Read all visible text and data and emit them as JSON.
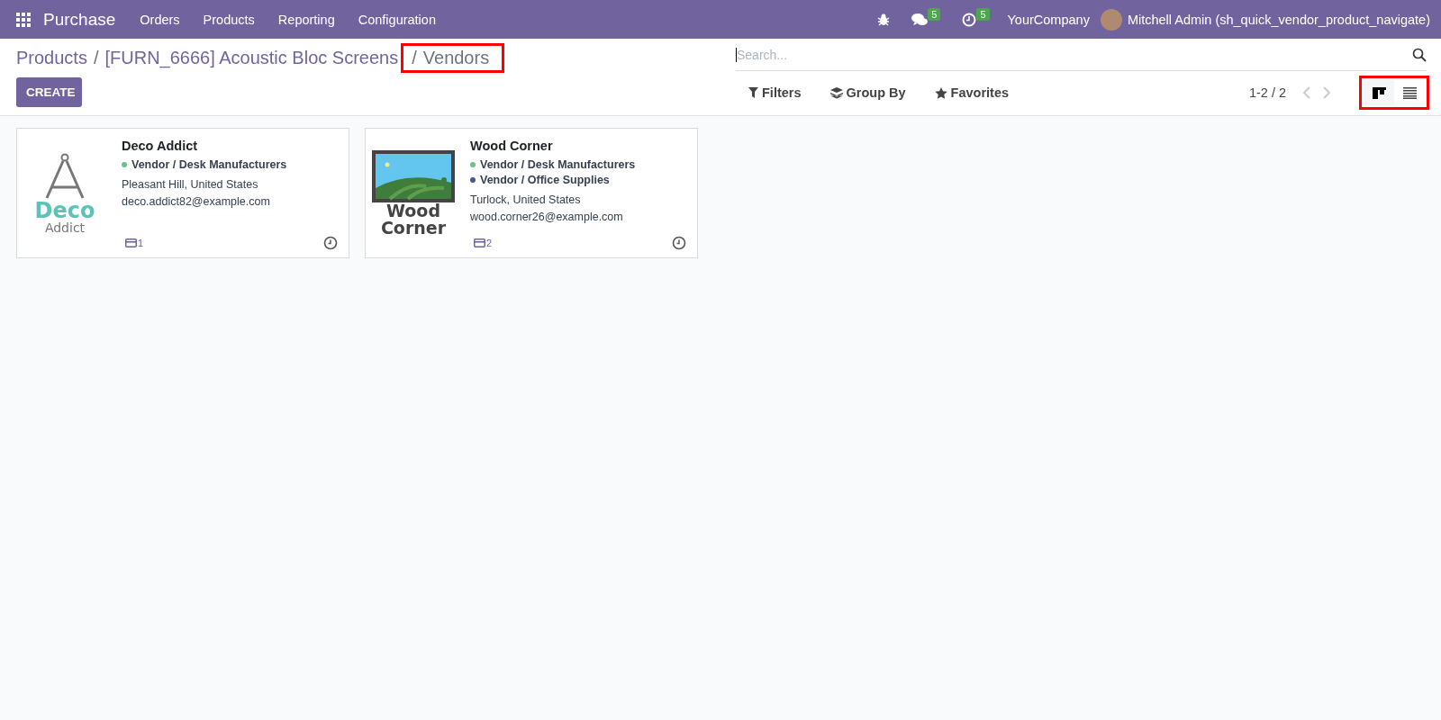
{
  "navbar": {
    "app_name": "Purchase",
    "menu": [
      "Orders",
      "Products",
      "Reporting",
      "Configuration"
    ],
    "messages_badge": "5",
    "activities_badge": "5",
    "company": "YourCompany",
    "user": "Mitchell Admin (sh_quick_vendor_product_navigate)"
  },
  "breadcrumb_separator": "/",
  "breadcrumbs": [
    {
      "label": "Products",
      "highlighted": false
    },
    {
      "label": "[FURN_6666] Acoustic Bloc Screens",
      "highlighted": false
    },
    {
      "label": "Vendors",
      "highlighted": true
    }
  ],
  "create_button": "CREATE",
  "search": {
    "placeholder": "Search..."
  },
  "filters": [
    "Filters",
    "Group By",
    "Favorites"
  ],
  "pager": "1-2 / 2",
  "view_switcher": {
    "highlighted": true,
    "views": [
      {
        "kind": "kanban",
        "selected": true
      },
      {
        "kind": "list",
        "selected": false
      }
    ]
  },
  "cards": [
    {
      "name": "Deco Addict",
      "logo": {
        "kind": "compass",
        "lines": [
          "Deco",
          "Addict"
        ]
      },
      "tags": [
        {
          "label": "Vendor / Desk Manufacturers",
          "color": "#6cc18a"
        }
      ],
      "location": "Pleasant Hill, United States",
      "email": "deco.addict82@example.com",
      "bank_count": "1"
    },
    {
      "name": "Wood Corner",
      "logo": {
        "kind": "landscape",
        "lines": [
          "Wood",
          "Corner"
        ]
      },
      "tags": [
        {
          "label": "Vendor / Desk Manufacturers",
          "color": "#6cc18a"
        },
        {
          "label": "Vendor / Office Supplies",
          "color": "#4c5a8a"
        }
      ],
      "location": "Turlock, United States",
      "email": "wood.corner26@example.com",
      "bank_count": "2"
    }
  ]
}
